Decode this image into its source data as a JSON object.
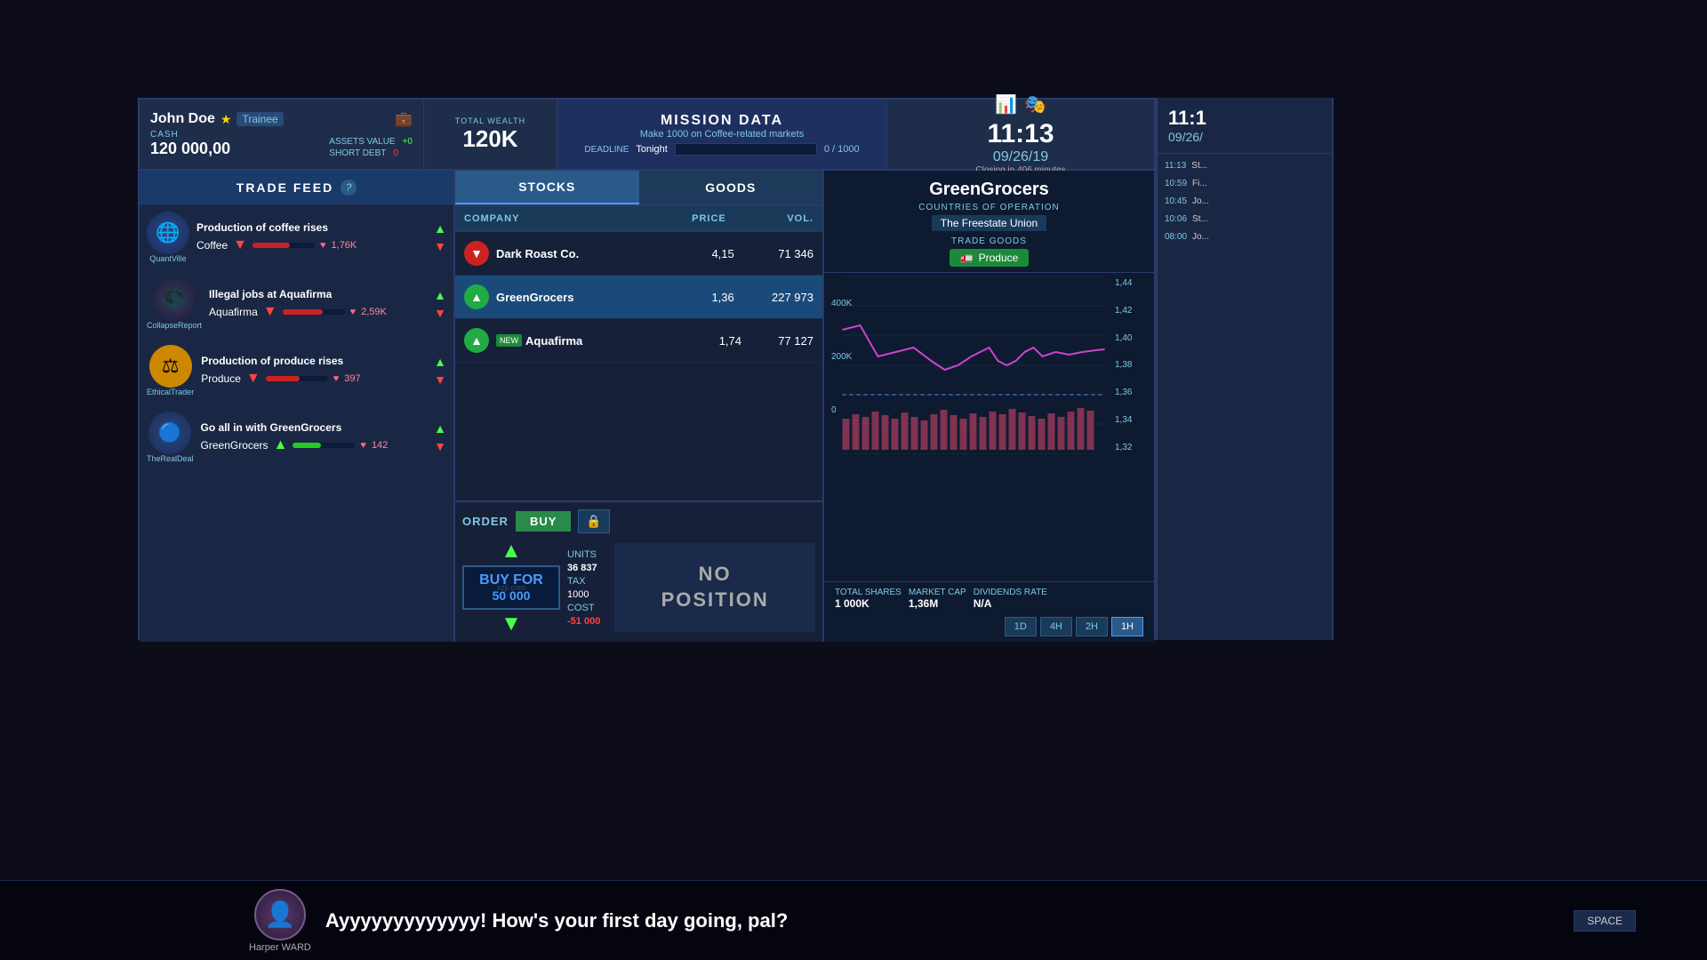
{
  "player": {
    "name": "John Doe",
    "rank": "Trainee",
    "cash_label": "CASH",
    "cash_value": "120 000,00",
    "total_wealth_label": "TOTAL WEALTH",
    "total_wealth": "120K",
    "assets_value_label": "ASSETS VALUE",
    "assets_value": "+0",
    "short_debt_label": "SHORT DEBT",
    "short_debt": "0"
  },
  "clock": {
    "time": "11:13",
    "date": "09/26/19",
    "closing_label": "Closing in 406 minutes"
  },
  "right_clock": {
    "time": "11:1",
    "date": "09/26/"
  },
  "mission": {
    "title": "MISSION DATA",
    "description": "Make 1000 on Coffee-related markets",
    "deadline_label": "DEADLINE",
    "deadline": "Tonight",
    "progress": "0 / 1000"
  },
  "trade_feed": {
    "title": "TRADE FEED",
    "help": "?",
    "items": [
      {
        "source": "QuantVille",
        "headline": "Production of coffee rises",
        "stock_name": "Coffee",
        "trend": "down",
        "likes": "1,76K",
        "avatar_emoji": "🌐"
      },
      {
        "source": "CollapseReport",
        "headline": "Illegal jobs at Aquafirma",
        "stock_name": "Aquafirma",
        "trend": "down",
        "likes": "2,59K",
        "avatar_emoji": "🌑"
      },
      {
        "source": "EthicalTrader",
        "headline": "Production of produce rises",
        "stock_name": "Produce",
        "trend": "down",
        "likes": "397",
        "avatar_emoji": "⚖"
      },
      {
        "source": "TheRealDeal",
        "headline": "Go all in with GreenGrocers",
        "stock_name": "GreenGrocers",
        "trend": "up",
        "likes": "142",
        "avatar_emoji": "🔵"
      }
    ]
  },
  "stocks_table": {
    "tabs": [
      "STOCKS",
      "GOODS"
    ],
    "active_tab": "STOCKS",
    "columns": [
      "COMPANY",
      "PRICE",
      "VOL."
    ],
    "rows": [
      {
        "name": "Dark Roast Co.",
        "price": "4,15",
        "vol": "71 346",
        "trend": "down",
        "is_new": false,
        "selected": false
      },
      {
        "name": "GreenGrocers",
        "price": "1,36",
        "vol": "227 973",
        "trend": "up",
        "is_new": false,
        "selected": true
      },
      {
        "name": "Aquafirma",
        "price": "1,74",
        "vol": "77 127",
        "trend": "up",
        "is_new": true,
        "selected": false
      }
    ]
  },
  "order": {
    "label": "ORDER",
    "buy_label": "BUY",
    "buy_for_label": "BUY FOR",
    "amount": "50 000",
    "units_label": "UNITS",
    "units_value": "36 837",
    "tax_label": "TAX",
    "tax_value": "1000",
    "cost_label": "COST",
    "cost_value": "-51 000"
  },
  "company_detail": {
    "name": "GreenGrocers",
    "countries_label": "COUNTRIES OF OPERATION",
    "country": "The Freestate Union",
    "trade_goods_label": "TRADE GOODS",
    "produce_label": "Produce",
    "no_position": "NO\nPOSITION"
  },
  "chart": {
    "y_labels": [
      "1,44",
      "1,42",
      "1,40",
      "1,38",
      "1,36",
      "1,34",
      "1,32"
    ],
    "x_labels": [
      "400K",
      "200K",
      "0"
    ]
  },
  "stats": {
    "total_shares_label": "TOTAL SHARES",
    "total_shares_value": "1 000K",
    "market_cap_label": "MARKET CAP",
    "market_cap_value": "1,36M",
    "dividends_label": "DIVIDENDS RATE",
    "dividends_value": "N/A"
  },
  "time_buttons": [
    "1D",
    "4H",
    "2H",
    "1H"
  ],
  "active_time": "1H",
  "news_feed": [
    {
      "time": "11:13",
      "text": "St..."
    },
    {
      "time": "10:59",
      "text": "Fi..."
    },
    {
      "time": "10:45",
      "text": "Jo..."
    },
    {
      "time": "10:06",
      "text": "St..."
    },
    {
      "time": "08:00",
      "text": "Jo..."
    }
  ],
  "chat": {
    "speaker": "Harper WARD",
    "message": "Ayyyyyyyyyyyyy! How's your first day going, pal?",
    "space_label": "SPACE"
  }
}
